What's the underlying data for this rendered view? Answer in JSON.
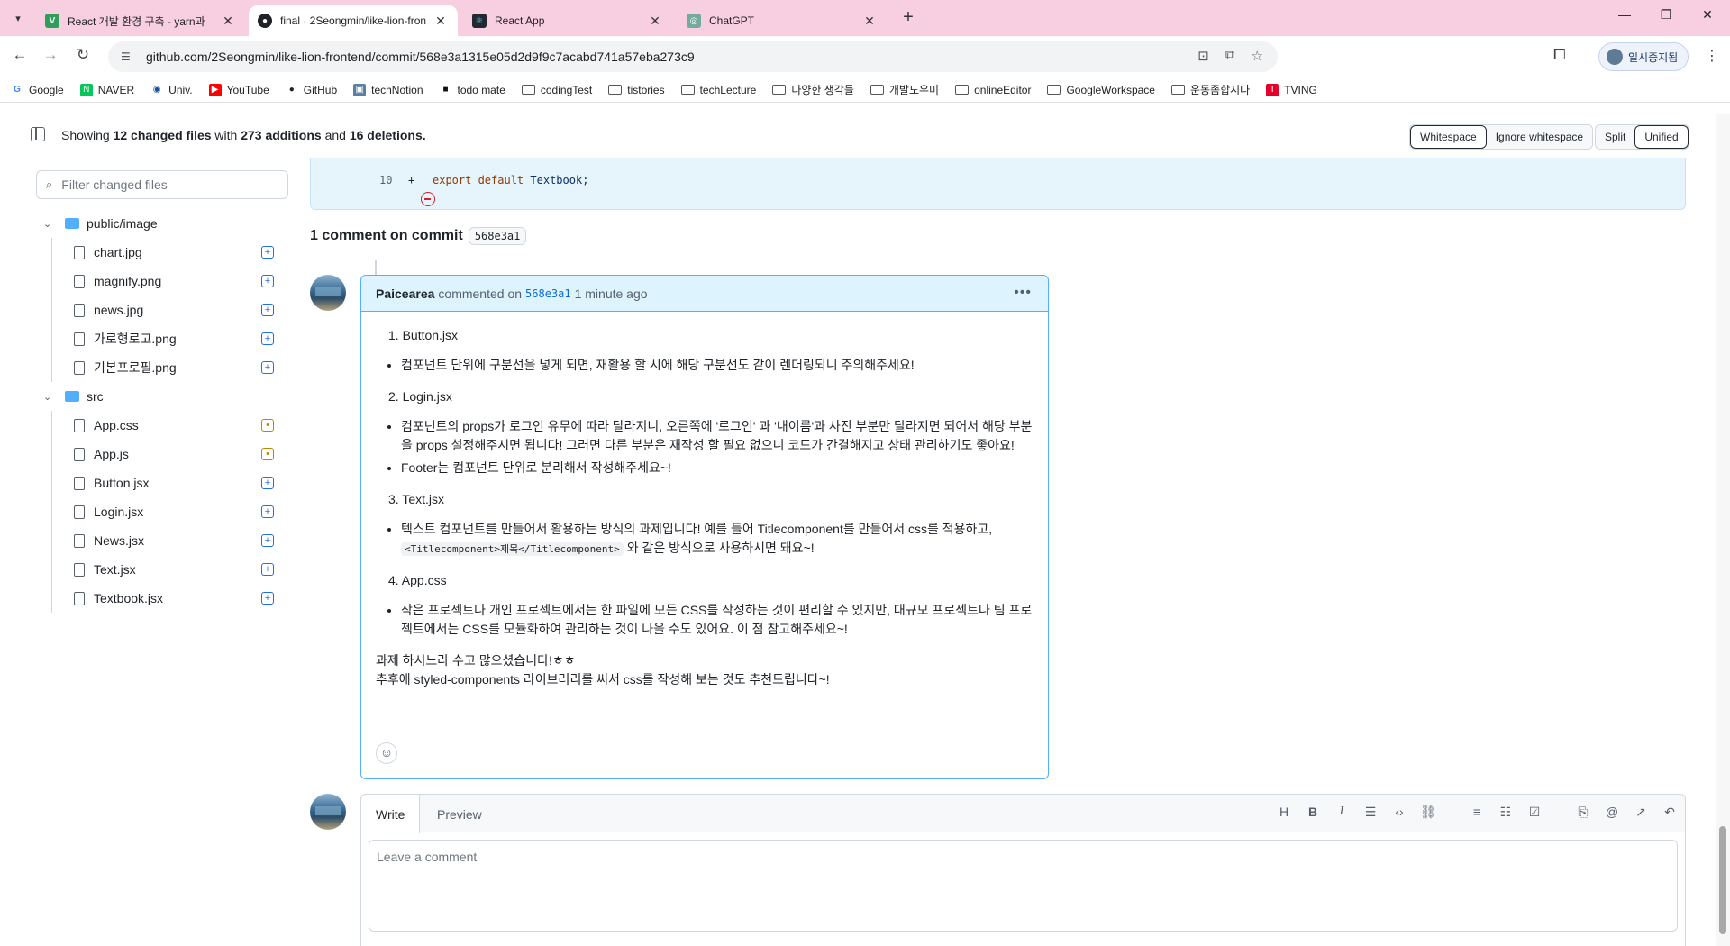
{
  "browser": {
    "tabs": [
      {
        "title": "React 개발 환경 구축 - yarn과",
        "favicon": "V",
        "color": "#2e9e5b"
      },
      {
        "title": "final · 2Seongmin/like-lion-fron",
        "favicon": "gh",
        "color": "#1f2328"
      },
      {
        "title": "React App",
        "favicon": "re",
        "color": "#23272f"
      },
      {
        "title": "ChatGPT",
        "favicon": "ai",
        "color": "#74aa9c"
      }
    ],
    "url": "github.com/2Seongmin/like-lion-frontend/commit/568e3a1315e05d2d9f9c7acabd741a57eba273c9",
    "profile_label": "일시중지됨",
    "bookmarks": [
      "Google",
      "NAVER",
      "Univ.",
      "YouTube",
      "GitHub",
      "techNotion",
      "todo mate",
      "codingTest",
      "tistories",
      "techLecture",
      "다양한 생각들",
      "개발도우미",
      "onlineEditor",
      "GoogleWorkspace",
      "운동좀합시다",
      "TVING"
    ]
  },
  "header": {
    "summary_prefix": "Showing",
    "files_changed": "12 changed files",
    "summary_with": "with",
    "additions": "273 additions",
    "summary_and": "and",
    "deletions": "16 deletions.",
    "whitespace_label": "Whitespace",
    "ignore_whitespace_label": "Ignore whitespace",
    "split_label": "Split",
    "unified_label": "Unified"
  },
  "file_filter": {
    "placeholder": "Filter changed files"
  },
  "file_tree": {
    "dirs": [
      {
        "name": "public/image",
        "files": [
          {
            "name": "chart.jpg",
            "status": "added"
          },
          {
            "name": "magnify.png",
            "status": "added"
          },
          {
            "name": "news.jpg",
            "status": "added"
          },
          {
            "name": "가로형로고.png",
            "status": "added"
          },
          {
            "name": "기본프로필.png",
            "status": "added"
          }
        ]
      },
      {
        "name": "src",
        "files": [
          {
            "name": "App.css",
            "status": "modified"
          },
          {
            "name": "App.js",
            "status": "modified"
          },
          {
            "name": "Button.jsx",
            "status": "added"
          },
          {
            "name": "Login.jsx",
            "status": "added"
          },
          {
            "name": "News.jsx",
            "status": "added"
          },
          {
            "name": "Text.jsx",
            "status": "added"
          },
          {
            "name": "Textbook.jsx",
            "status": "added"
          }
        ]
      }
    ]
  },
  "diff": {
    "line_number": "10",
    "marker": "+",
    "keyword": "export default",
    "identifier": "Textbook;"
  },
  "comments_section": {
    "title": "1 comment on commit",
    "sha": "568e3a1"
  },
  "comment": {
    "author": "Paicearea",
    "action": "commented on",
    "sha": "568e3a1",
    "time": "1 minute ago",
    "sections": [
      {
        "heading": "1. Button.jsx",
        "bullets": [
          "컴포넌트 단위에 구분선을 넣게 되면, 재활용 할 시에 해당 구분선도 같이 렌더링되니 주의해주세요!"
        ]
      },
      {
        "heading": "2. Login.jsx",
        "bullets": [
          "컴포넌트의 props가 로그인 유무에 따라 달라지니, 오른쪽에 '로그인' 과 '내이름'과 사진 부분만 달라지면 되어서 해당 부분을 props 설정해주시면 됩니다! 그러면 다른 부분은 재작성 할 필요 없으니 코드가 간결해지고 상태 관리하기도 좋아요!",
          "Footer는 컴포넌트 단위로 분리해서 작성해주세요~!"
        ]
      },
      {
        "heading": "3. Text.jsx",
        "bullets": []
      },
      {
        "heading": "4. App.css",
        "bullets": [
          "작은 프로젝트나 개인 프로젝트에서는 한 파일에 모든 CSS를 작성하는 것이 편리할 수 있지만, 대규모 프로젝트나 팀 프로젝트에서는 CSS를 모듈화하여 관리하는 것이 나을 수도 있어요. 이 점 참고해주세요~!"
        ]
      }
    ],
    "text_bullet_a": "텍스트 컴포넌트를 만들어서 활용하는 방식의 과제입니다! 예를 들어 Titlecomponent를 만들어서 css를 적용하고,",
    "text_bullet_code": "<Titlecomponent>제목</Titlecomponent>",
    "text_bullet_b": "와 같은 방식으로 사용하시면 돼요~!",
    "closing_1": "과제 하시느라 수고 많으셨습니다!ㅎㅎ",
    "closing_2": "추후에 styled-components 라이브러리를 써서 css를 작성해 보는 것도 추천드립니다~!"
  },
  "new_comment": {
    "write_tab": "Write",
    "preview_tab": "Preview",
    "placeholder": "Leave a comment"
  }
}
